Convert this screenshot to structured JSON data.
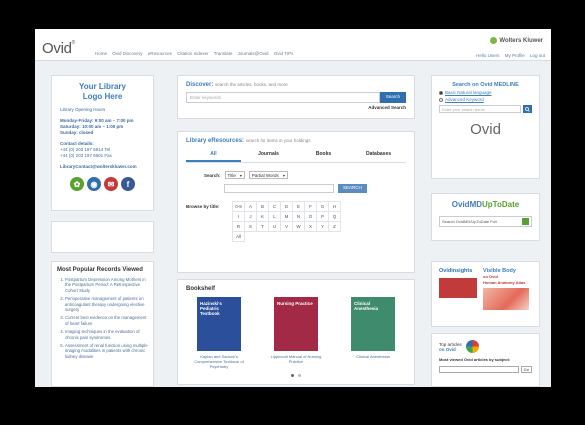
{
  "header": {
    "logo": "Ovid",
    "nav": [
      "Home",
      "Ovid Discovery",
      "eResources",
      "Citation Indexer",
      "Translate",
      "Journals@Ovid",
      "Ovid TIPs"
    ],
    "brand": "Wolters Kluwer",
    "links": [
      "Hello Users",
      "My Profile",
      "Log out"
    ]
  },
  "library": {
    "title_line1": "Your Library",
    "title_line2": "Logo Here",
    "hours_label": "Library Opening Hours",
    "hours": [
      "Monday-Friday: 9:00 am – 7:00 pm",
      "Saturday: 10:00 am – 1:00 pm",
      "Sunday: closed"
    ],
    "contact_label": "Contact details:",
    "contact": [
      "+44 (0) 203 197 6814 Tel",
      "+44 (0) 203 197 6601 Fax"
    ],
    "email": "LibraryContact@wolterskluwer.com",
    "social": [
      {
        "icon": "leaf-icon",
        "color": "#5aa02c"
      },
      {
        "icon": "globe-icon",
        "color": "#2f6fae"
      },
      {
        "icon": "news-icon",
        "color": "#c23b3b"
      },
      {
        "icon": "facebook-icon",
        "color": "#3b5998"
      }
    ]
  },
  "popular": {
    "title": "Most Popular Records Viewed",
    "items": [
      "Postpartum Depression Among Mothers in the Postpartum Period: A Retrospective Cohort Study",
      "Perioperative management of patients on anticoagulant therapy undergoing elective surgery",
      "Current best evidence on the management of heart failure",
      "Imaging techniques in the evaluation of chronic pain syndromes",
      "Assessment of renal function using multiple imaging modalities in patients with chronic kidney disease"
    ]
  },
  "discover": {
    "title": "Discover:",
    "subtitle": "search the articles, books, and more",
    "placeholder": "Enter keywords",
    "button": "Search",
    "advanced": "Advanced Search"
  },
  "eresources": {
    "title": "Library eResources:",
    "subtitle": "search for items in your holdings",
    "tabs": [
      "All",
      "Journals",
      "Books",
      "Databases"
    ],
    "search_label": "Search:",
    "field": "Title",
    "match": "Partial Words",
    "go": "SEARCH",
    "browse_label": "Browse by title:",
    "letters": [
      "0-9",
      "A",
      "B",
      "C",
      "D",
      "E",
      "F",
      "G",
      "H",
      "I",
      "J",
      "K",
      "L",
      "M",
      "N",
      "O",
      "P",
      "Q",
      "R",
      "S",
      "T",
      "U",
      "V",
      "W",
      "X",
      "Y",
      "Z",
      "All"
    ]
  },
  "bookshelf": {
    "title": "Bookshelf",
    "books": [
      {
        "cover_title": "Hazinski's Pediatric Textbook",
        "caption": "Kaplan and Sadock's Comprehensive Textbook of Psychiatry",
        "color": "#2b4f9a"
      },
      {
        "cover_title": "Nursing Practice",
        "caption": "Lippincott Manual of Nursing Practice",
        "color": "#a22a46"
      },
      {
        "cover_title": "Clinical Anesthesia",
        "caption": "Clinical Anesthesia",
        "color": "#3f8b6d"
      }
    ]
  },
  "medline": {
    "title": "Search on Ovid MEDLINE",
    "options": [
      "Basic Natural language",
      "Advanced Keyword"
    ],
    "placeholder": "Enter your search terms",
    "logo": "Ovid"
  },
  "uptodate": {
    "logo_a": "OvidMD",
    "logo_b": "UpToDate",
    "placeholder": "Search OvidMD/UpToDate Full"
  },
  "insights": {
    "logo": "Ovidinsights",
    "visible_body": "Visible Body",
    "visible_body_sub": "on Ovid",
    "visible_body_tag": "Human Anatomy Atlas"
  },
  "top_articles": {
    "label_a": "Top articles",
    "label_b": "on Ovid",
    "subject_label": "Most viewed Ovid articles by subject:",
    "go": "Go"
  }
}
